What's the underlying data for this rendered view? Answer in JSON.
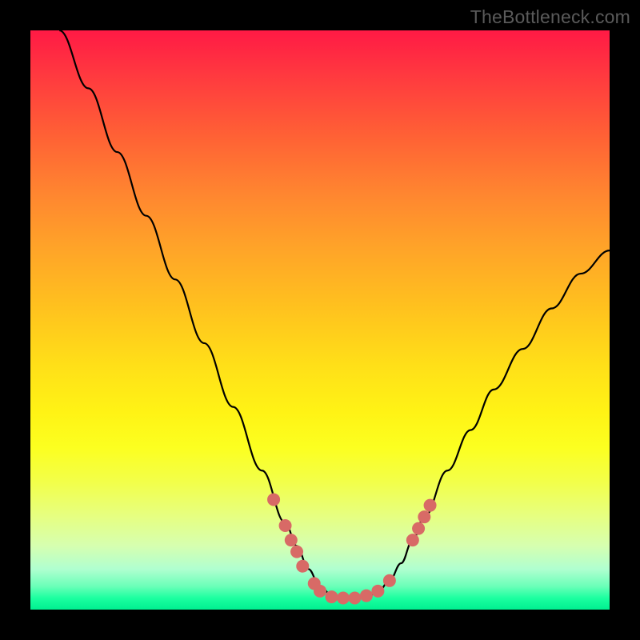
{
  "watermark": "TheBottleneck.com",
  "chart_data": {
    "type": "line",
    "title": "",
    "xlabel": "",
    "ylabel": "",
    "xlim": [
      0,
      100
    ],
    "ylim": [
      0,
      100
    ],
    "description": "V-shaped bottleneck curve over rainbow gradient (red-top to green-bottom). Curve starts top-left, descends steeply to a flat minimum near x≈48-60, rises again toward right edge. Pink marker dots cluster near the minimum on both flanks.",
    "series": [
      {
        "name": "curve",
        "x": [
          5,
          10,
          15,
          20,
          25,
          30,
          35,
          40,
          44,
          46,
          48,
          50,
          52,
          54,
          56,
          58,
          60,
          62,
          64,
          66,
          68,
          72,
          76,
          80,
          85,
          90,
          95,
          100
        ],
        "y": [
          100,
          90,
          79,
          68,
          57,
          46,
          35,
          24,
          15,
          11,
          7,
          4,
          2.5,
          2,
          2,
          2.2,
          3,
          5,
          8,
          12,
          16,
          24,
          31,
          38,
          45,
          52,
          58,
          62
        ]
      }
    ],
    "markers": {
      "name": "highlight-dots",
      "color": "#d86a66",
      "points": [
        {
          "x": 42,
          "y": 19
        },
        {
          "x": 44,
          "y": 14.5
        },
        {
          "x": 45,
          "y": 12
        },
        {
          "x": 46,
          "y": 10
        },
        {
          "x": 47,
          "y": 7.5
        },
        {
          "x": 49,
          "y": 4.5
        },
        {
          "x": 50,
          "y": 3.2
        },
        {
          "x": 52,
          "y": 2.2
        },
        {
          "x": 54,
          "y": 2
        },
        {
          "x": 56,
          "y": 2
        },
        {
          "x": 58,
          "y": 2.4
        },
        {
          "x": 60,
          "y": 3.2
        },
        {
          "x": 62,
          "y": 5
        },
        {
          "x": 66,
          "y": 12
        },
        {
          "x": 67,
          "y": 14
        },
        {
          "x": 68,
          "y": 16
        },
        {
          "x": 69,
          "y": 18
        }
      ]
    },
    "gradient_stops": [
      {
        "pos": 0,
        "color": "#ff1a45"
      },
      {
        "pos": 50,
        "color": "#ffd21a"
      },
      {
        "pos": 100,
        "color": "#00f090"
      }
    ]
  }
}
